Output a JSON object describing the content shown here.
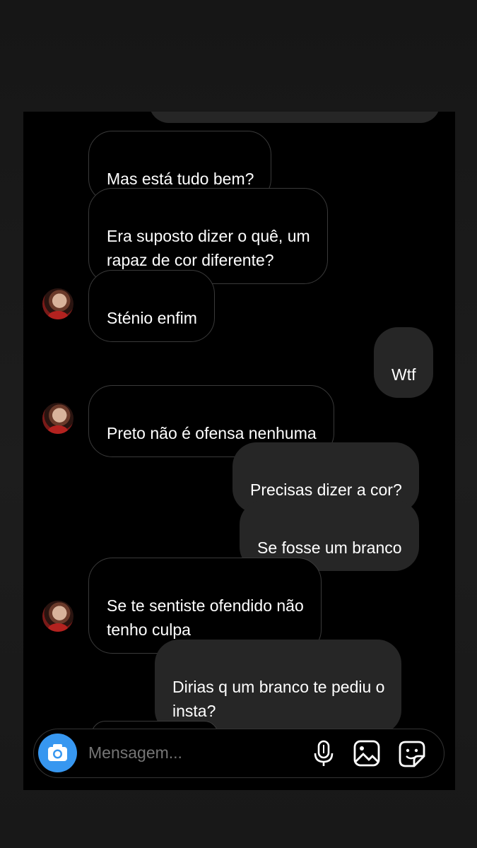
{
  "messages": [
    {
      "text": "Mas está tudo bem?",
      "side": "incoming",
      "avatar": false
    },
    {
      "text": "Era suposto dizer o quê, um\nrapaz de cor diferente?",
      "side": "incoming",
      "avatar": false
    },
    {
      "text": "Sténio enfim",
      "side": "incoming",
      "avatar": true
    },
    {
      "text": "Wtf",
      "side": "outgoing"
    },
    {
      "text": "Preto não é ofensa nenhuma",
      "side": "incoming",
      "avatar": true
    },
    {
      "text": "Precisas dizer a cor?",
      "side": "outgoing"
    },
    {
      "text": "Se fosse um branco",
      "side": "outgoing"
    },
    {
      "text": "Se te sentiste ofendido não\ntenho culpa",
      "side": "incoming",
      "avatar": true
    },
    {
      "text": "Dirias q um branco te pediu o\ninsta?",
      "side": "outgoing"
    }
  ],
  "composer": {
    "placeholder": "Mensagem...",
    "camera_icon": "camera-icon",
    "mic_icon": "microphone-icon",
    "gallery_icon": "gallery-icon",
    "sticker_icon": "sticker-icon"
  },
  "colors": {
    "accent": "#3797f0",
    "incoming_bubble_border": "#3a3a3a",
    "outgoing_bubble": "#262626",
    "background": "#000000"
  }
}
